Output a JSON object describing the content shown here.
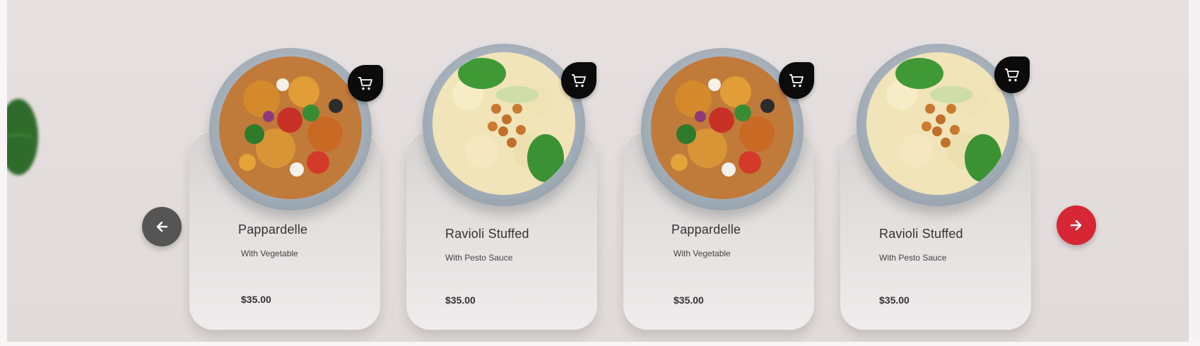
{
  "carousel": {
    "prev_icon": "arrow-left-icon",
    "next_icon": "arrow-right-icon",
    "items": [
      {
        "title": "Pappardelle",
        "subtitle": "With Vegetable",
        "price": "$35.00",
        "image": "pasta-salad-tomato"
      },
      {
        "title": "Ravioli Stuffed",
        "subtitle": "With Pesto Sauce",
        "price": "$35.00",
        "image": "farfalle-chickpea-basil"
      },
      {
        "title": "Pappardelle",
        "subtitle": "With Vegetable",
        "price": "$35.00",
        "image": "pasta-salad-tomato"
      },
      {
        "title": "Ravioli Stuffed",
        "subtitle": "With Pesto Sauce",
        "price": "$35.00",
        "image": "farfalle-chickpea-basil"
      }
    ]
  },
  "colors": {
    "next_button": "#d72735",
    "prev_button": "#555555",
    "cart_button": "#0b0b0b"
  }
}
